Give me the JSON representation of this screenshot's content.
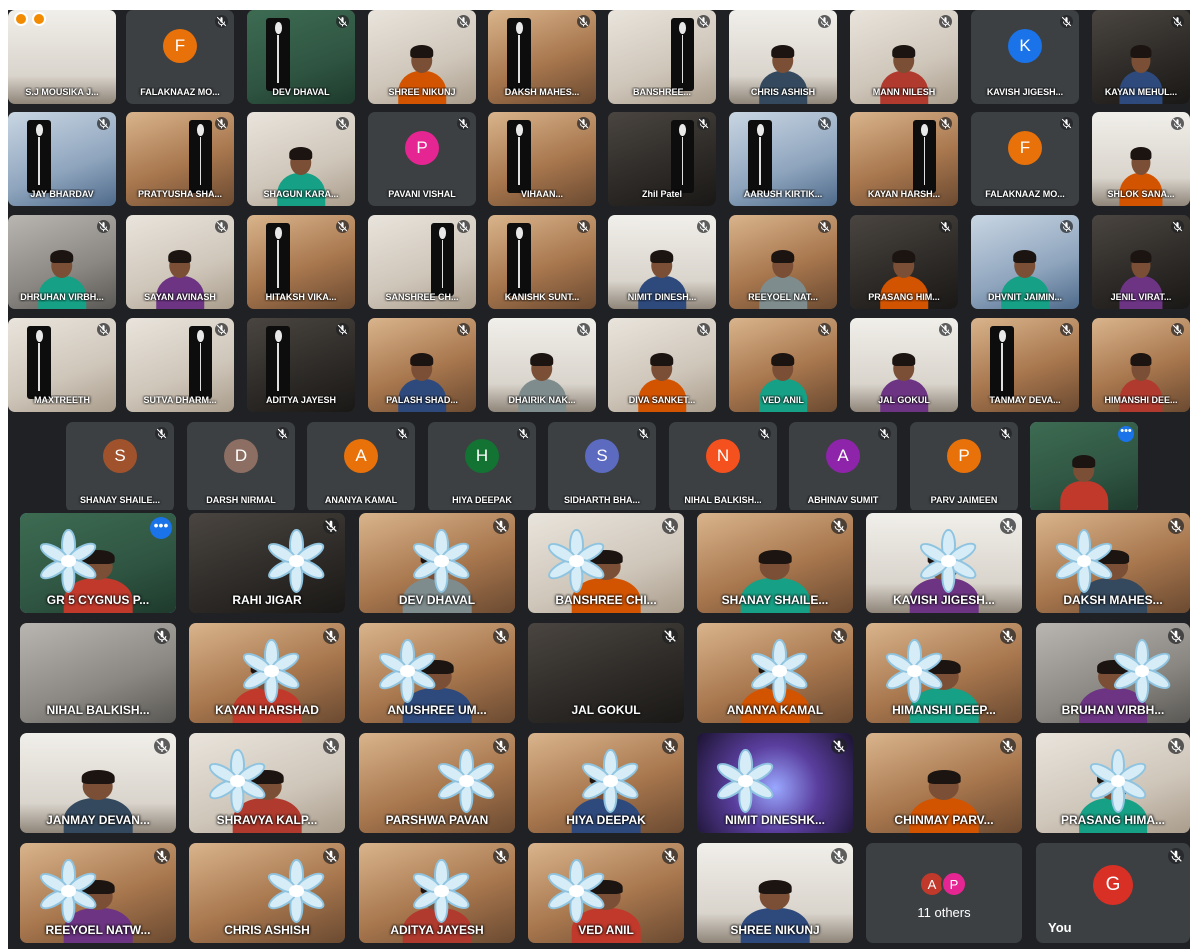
{
  "screen1": {
    "rows": [
      [
        {
          "name": "S.J MOUSIKA J...",
          "scene": "lightwall",
          "icons": true
        },
        {
          "name": "FALAKNAAZ MO...",
          "avatar": "F",
          "color": "#e8710a",
          "mute": true
        },
        {
          "name": "DEV DHAVAL",
          "scene": "green",
          "prop": "skeleton",
          "mute": true
        },
        {
          "name": "SHREE NIKUNJ",
          "scene": "light",
          "person": true,
          "mute": true
        },
        {
          "name": "DAKSH MAHES...",
          "scene": "warm",
          "prop": "skeleton",
          "mute": true
        },
        {
          "name": "BANSHREE...",
          "scene": "light",
          "prop": "skeleton",
          "mute": true
        },
        {
          "name": "CHRIS ASHISH",
          "scene": "lightwall",
          "person": true,
          "mute": true
        },
        {
          "name": "MANN NILESH",
          "scene": "light",
          "person": true,
          "mute": true
        },
        {
          "name": "KAVISH JIGESH...",
          "avatar": "K",
          "color": "#1a73e8",
          "mute": true
        },
        {
          "name": "KAYAN MEHUL...",
          "scene": "dark",
          "person": true,
          "mute": true
        }
      ],
      [
        {
          "name": "JAY BHARDAV",
          "scene": "blue",
          "prop": "skeleton",
          "mute": true
        },
        {
          "name": "PRATYUSHA SHA...",
          "scene": "warm",
          "prop": "skeleton",
          "mute": true
        },
        {
          "name": "SHAGUN KARA...",
          "scene": "light",
          "person": true,
          "mute": true
        },
        {
          "name": "PAVANI VISHAL",
          "avatar": "P",
          "color": "#e52592",
          "mute": true
        },
        {
          "name": "VIHAAN...",
          "scene": "warm",
          "prop": "skeleton",
          "mute": true
        },
        {
          "name": "Zhil Patel",
          "scene": "dark",
          "prop": "skeleton",
          "mute": true
        },
        {
          "name": "AARUSH KIRTIK...",
          "scene": "blue",
          "prop": "skeleton",
          "mute": true
        },
        {
          "name": "KAYAN HARSH...",
          "scene": "warm",
          "prop": "skeleton",
          "mute": true
        },
        {
          "name": "FALAKNAAZ MO...",
          "avatar": "F",
          "color": "#e8710a",
          "mute": true
        },
        {
          "name": "SHLOK SANA...",
          "scene": "lightwall",
          "person": true,
          "mute": true
        }
      ],
      [
        {
          "name": "DHRUHAN VIRBH...",
          "scene": "grey",
          "person": true,
          "mute": true
        },
        {
          "name": "SAYAN AVINASH",
          "scene": "light",
          "person": true,
          "mute": true
        },
        {
          "name": "HITAKSH VIKA...",
          "scene": "warm",
          "prop": "skeleton",
          "mute": true
        },
        {
          "name": "SANSHREE CH...",
          "scene": "light",
          "prop": "skeleton",
          "mute": true
        },
        {
          "name": "KANISHK SUNT...",
          "scene": "warm",
          "prop": "skeleton",
          "mute": true
        },
        {
          "name": "NIMIT DINESH...",
          "scene": "lightwall",
          "person": true,
          "mute": true
        },
        {
          "name": "REEYOEL NAT...",
          "scene": "warm",
          "person": true,
          "mute": true
        },
        {
          "name": "PRASANG HIM...",
          "scene": "dark",
          "person": true,
          "mute": true
        },
        {
          "name": "DHVNIT JAIMIN...",
          "scene": "blue",
          "person": true,
          "mute": true
        },
        {
          "name": "JENIL VIRAT...",
          "scene": "dark",
          "person": true,
          "mute": true
        }
      ],
      [
        {
          "name": "MAXTREETH",
          "scene": "light",
          "prop": "skeleton",
          "mute": true
        },
        {
          "name": "SUTVA DHARM...",
          "scene": "light",
          "prop": "skeleton",
          "mute": true
        },
        {
          "name": "ADITYA JAYESH",
          "scene": "dark",
          "prop": "skeleton",
          "mute": true
        },
        {
          "name": "PALASH SHAD...",
          "scene": "warm",
          "person": true,
          "mute": true
        },
        {
          "name": "DHAIRIK NAK...",
          "scene": "lightwall",
          "person": true,
          "mute": true
        },
        {
          "name": "DIVA SANKET...",
          "scene": "light",
          "person": true,
          "mute": true
        },
        {
          "name": "VED ANIL",
          "scene": "warm",
          "person": true,
          "mute": true
        },
        {
          "name": "JAL GOKUL",
          "scene": "lightwall",
          "person": true,
          "mute": true
        },
        {
          "name": "TANMAY DEVA...",
          "scene": "warm",
          "prop": "skeleton",
          "mute": true
        },
        {
          "name": "HIMANSHI DEE...",
          "scene": "warm",
          "person": true,
          "mute": true
        }
      ]
    ],
    "row5": [
      {
        "name": "SHANAY SHAILE...",
        "avatar": "S",
        "color": "#a0522d",
        "mute": true
      },
      {
        "name": "DARSH NIRMAL",
        "avatar": "D",
        "color": "#8d6e63",
        "mute": true
      },
      {
        "name": "ANANYA KAMAL",
        "avatar": "A",
        "color": "#e8710a",
        "mute": true
      },
      {
        "name": "HIYA DEEPAK",
        "avatar": "H",
        "color": "#137333",
        "mute": true
      },
      {
        "name": "SIDHARTH BHA...",
        "avatar": "S",
        "color": "#5c6bc0",
        "mute": true
      },
      {
        "name": "NIHAL BALKISH...",
        "avatar": "N",
        "color": "#f4511e",
        "mute": true
      },
      {
        "name": "ABHINAV SUMIT",
        "avatar": "A",
        "color": "#8e24aa",
        "mute": true
      },
      {
        "name": "PARV JAIMEEN",
        "avatar": "P",
        "color": "#e8710a",
        "mute": true
      },
      {
        "name": "",
        "scene": "green",
        "person": true,
        "more": true,
        "highlight": true
      }
    ]
  },
  "screen2": {
    "rows": [
      [
        {
          "name": "GR 5 CYGNUS P...",
          "scene": "green",
          "prop": "flower",
          "person": true,
          "more": true,
          "highlight": true
        },
        {
          "name": "RAHI JIGAR",
          "scene": "dark",
          "prop": "flower",
          "mute": true
        },
        {
          "name": "DEV DHAVAL",
          "scene": "warm",
          "prop": "flower",
          "person": true,
          "mute": true
        },
        {
          "name": "BANSHREE CHI...",
          "scene": "light",
          "prop": "flower",
          "person": true,
          "mute": true
        },
        {
          "name": "SHANAY SHAILE...",
          "scene": "warm",
          "person": true,
          "mute": true
        },
        {
          "name": "KAVISH JIGESH...",
          "scene": "lightwall",
          "prop": "flower",
          "person": true,
          "mute": true
        },
        {
          "name": "DAKSH MAHES...",
          "scene": "warm",
          "prop": "flower",
          "person": true,
          "mute": true
        }
      ],
      [
        {
          "name": "NIHAL BALKISH...",
          "scene": "grey",
          "mute": true
        },
        {
          "name": "KAYAN HARSHAD",
          "scene": "warm",
          "prop": "flower",
          "person": true,
          "mute": true
        },
        {
          "name": "ANUSHREE UM...",
          "scene": "warm",
          "prop": "flower",
          "person": true,
          "mute": true
        },
        {
          "name": "JAL GOKUL",
          "scene": "dark",
          "mute": true
        },
        {
          "name": "ANANYA KAMAL",
          "scene": "warm",
          "prop": "flower",
          "person": true,
          "mute": true
        },
        {
          "name": "HIMANSHI DEEP...",
          "scene": "warm",
          "prop": "flower",
          "person": true,
          "mute": true
        },
        {
          "name": "BRUHAN VIRBH...",
          "scene": "grey",
          "prop": "flower",
          "person": true,
          "mute": true
        }
      ],
      [
        {
          "name": "JANMAY DEVAN...",
          "scene": "lightwall",
          "person": true,
          "mute": true
        },
        {
          "name": "SHRAVYA KALP...",
          "scene": "light",
          "prop": "flower",
          "person": true,
          "mute": true
        },
        {
          "name": "PARSHWA PAVAN",
          "scene": "warm",
          "prop": "flower",
          "mute": true
        },
        {
          "name": "HIYA DEEPAK",
          "scene": "warm",
          "prop": "flower",
          "person": true,
          "mute": true
        },
        {
          "name": "NIMIT DINESHK...",
          "scene": "purple",
          "prop": "flower",
          "mute": true
        },
        {
          "name": "CHINMAY PARV...",
          "scene": "warm",
          "person": true,
          "mute": true
        },
        {
          "name": "PRASANG HIMA...",
          "scene": "light",
          "prop": "flower",
          "person": true,
          "mute": true
        }
      ],
      [
        {
          "name": "REEYOEL NATW...",
          "scene": "warm",
          "prop": "flower",
          "person": true,
          "mute": true
        },
        {
          "name": "CHRIS ASHISH",
          "scene": "warm",
          "prop": "flower",
          "mute": true
        },
        {
          "name": "ADITYA JAYESH",
          "scene": "warm",
          "prop": "flower",
          "person": true,
          "mute": true
        },
        {
          "name": "VED ANIL",
          "scene": "warm",
          "prop": "flower",
          "person": true,
          "mute": true
        },
        {
          "name": "SHREE NIKUNJ",
          "scene": "lightwall",
          "person": true,
          "mute": true
        },
        {
          "others": true,
          "a": "A",
          "b": "P",
          "text": "11 others"
        },
        {
          "you": true,
          "avatar": "G",
          "label": "You",
          "color": "#d93025",
          "mute": true
        }
      ]
    ]
  }
}
